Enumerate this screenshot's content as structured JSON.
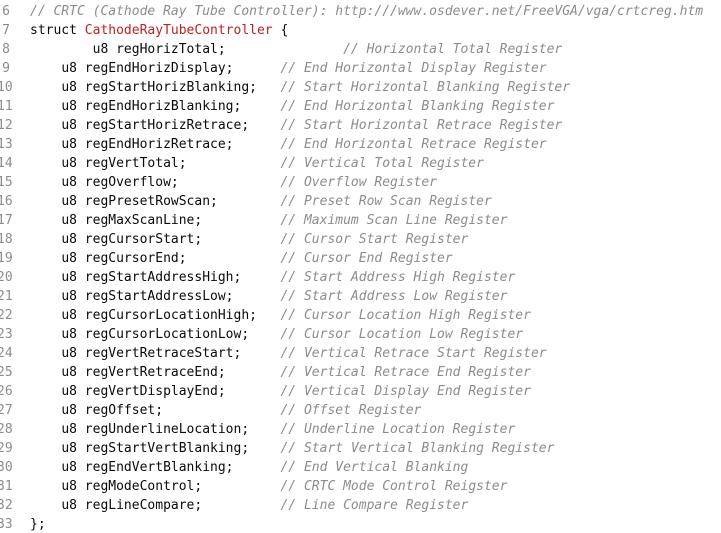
{
  "editor": {
    "lines": [
      {
        "num": "6",
        "comment": "// CRTC (Cathode Ray Tube Controller): http:///www.osdever.net/FreeVGA/vga/crtcreg.htm"
      },
      {
        "num": "7",
        "keyword": "struct",
        "name": "CathodeRayTubeController",
        "brace": "{"
      },
      {
        "num": "8",
        "type": "u8",
        "field": "regHorizTotal;",
        "comment": "// Horizontal Total Register"
      },
      {
        "num": "9",
        "type": "u8",
        "field": "regEndHorizDisplay;",
        "comment": "// End Horizontal Display Register"
      },
      {
        "num": "10",
        "type": "u8",
        "field": "regStartHorizBlanking;",
        "comment": "// Start Horizontal Blanking Register"
      },
      {
        "num": "11",
        "type": "u8",
        "field": "regEndHorizBlanking;",
        "comment": "// End Horizontal Blanking Register"
      },
      {
        "num": "12",
        "type": "u8",
        "field": "regStartHorizRetrace;",
        "comment": "// Start Horizontal Retrace Register"
      },
      {
        "num": "13",
        "type": "u8",
        "field": "regEndHorizRetrace;",
        "comment": "// End Horizontal Retrace Register"
      },
      {
        "num": "14",
        "type": "u8",
        "field": "regVertTotal;",
        "comment": "// Vertical Total Register"
      },
      {
        "num": "15",
        "type": "u8",
        "field": "regOverflow;",
        "comment": "// Overflow Register"
      },
      {
        "num": "16",
        "type": "u8",
        "field": "regPresetRowScan;",
        "comment": "// Preset Row Scan Register"
      },
      {
        "num": "17",
        "type": "u8",
        "field": "regMaxScanLine;",
        "comment": "// Maximum Scan Line Register"
      },
      {
        "num": "18",
        "type": "u8",
        "field": "regCursorStart;",
        "comment": "// Cursor Start Register"
      },
      {
        "num": "19",
        "type": "u8",
        "field": "regCursorEnd;",
        "comment": "// Cursor End Register"
      },
      {
        "num": "20",
        "type": "u8",
        "field": "regStartAddressHigh;",
        "comment": "// Start Address High Register"
      },
      {
        "num": "21",
        "type": "u8",
        "field": "regStartAddressLow;",
        "comment": "// Start Address Low Register"
      },
      {
        "num": "22",
        "type": "u8",
        "field": "regCursorLocationHigh;",
        "comment": "// Cursor Location High Register"
      },
      {
        "num": "23",
        "type": "u8",
        "field": "regCursorLocationLow;",
        "comment": "// Cursor Location Low Register"
      },
      {
        "num": "24",
        "type": "u8",
        "field": "regVertRetraceStart;",
        "comment": "// Vertical Retrace Start Register"
      },
      {
        "num": "25",
        "type": "u8",
        "field": "regVertRetraceEnd;",
        "comment": "// Vertical Retrace End Register"
      },
      {
        "num": "26",
        "type": "u8",
        "field": "regVertDisplayEnd;",
        "comment": "// Vertical Display End Register"
      },
      {
        "num": "27",
        "type": "u8",
        "field": "regOffset;",
        "comment": "// Offset Register"
      },
      {
        "num": "28",
        "type": "u8",
        "field": "regUnderlineLocation;",
        "comment": "// Underline Location Register"
      },
      {
        "num": "29",
        "type": "u8",
        "field": "regStartVertBlanking;",
        "comment": "// Start Vertical Blanking Register"
      },
      {
        "num": "30",
        "type": "u8",
        "field": "regEndVertBlanking;",
        "comment": "// End Vertical Blanking"
      },
      {
        "num": "31",
        "type": "u8",
        "field": "regModeControl;",
        "comment": "// CRTC Mode Control Reigster"
      },
      {
        "num": "32",
        "type": "u8",
        "field": "regLineCompare;",
        "comment": "// Line Compare Register"
      },
      {
        "num": "33",
        "closing": "};"
      }
    ]
  },
  "colors": {
    "background": "#ffffff",
    "text": "#0a0a0a",
    "comment": "#8c8c8c",
    "struct_name": "#c21f1f",
    "line_number": "#8c8c8c"
  }
}
